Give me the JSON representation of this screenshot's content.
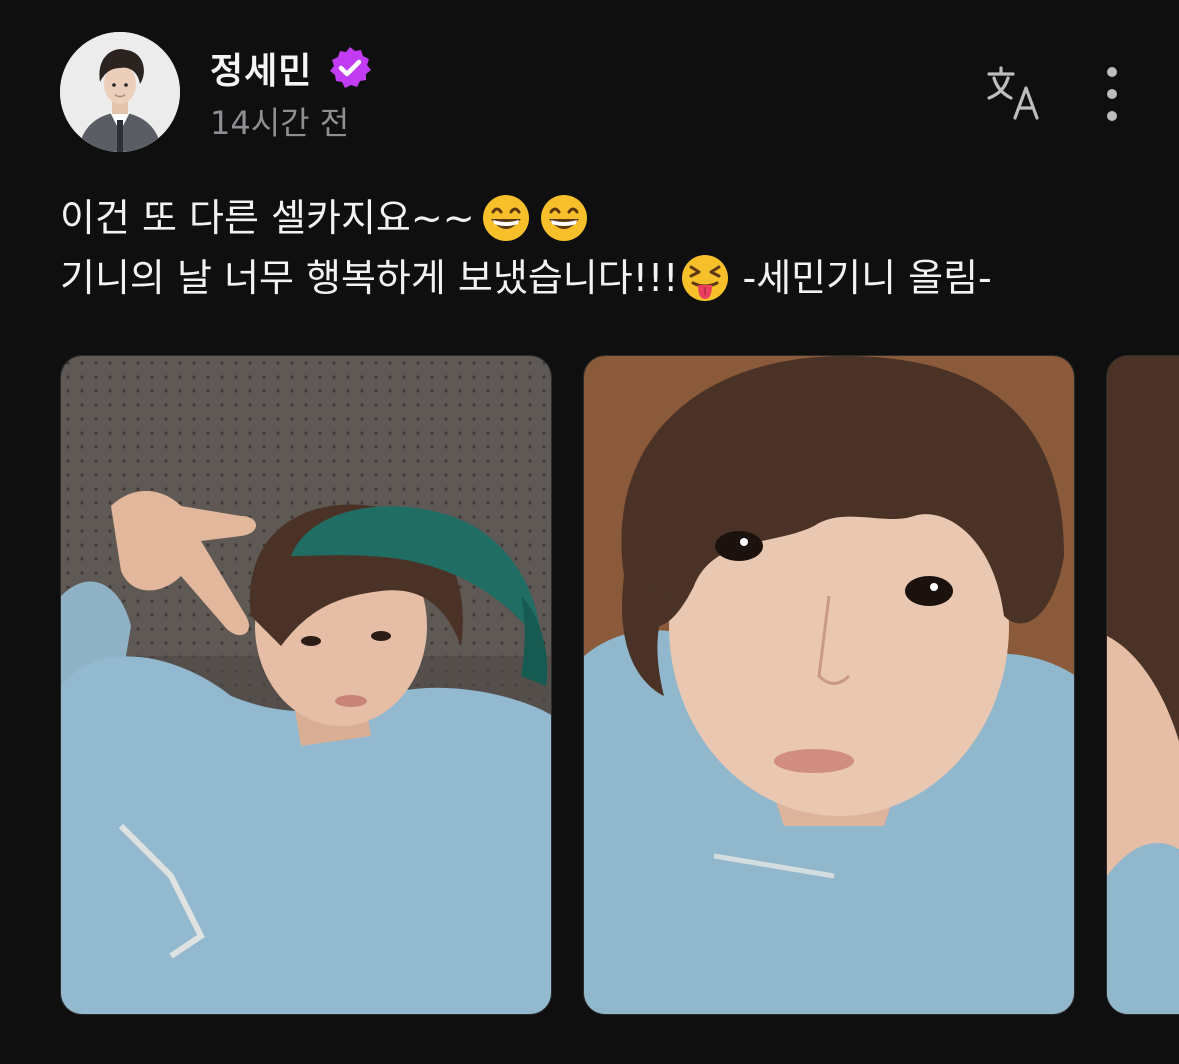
{
  "author": {
    "name": "정세민",
    "timestamp": "14시간 전",
    "verified": true,
    "avatar_icon": "avatar-photo",
    "badge_color": "#c13cf2"
  },
  "actions": {
    "translate_icon": "translate-icon",
    "more_icon": "more-vertical-icon"
  },
  "post": {
    "line1_text": "이건 또 다른 셀카지요~~",
    "line1_emojis": [
      "grinning-face-icon",
      "grinning-face-icon"
    ],
    "line2_text": "기니의 날 너무 행복하게 보냈습니다!!!",
    "line2_emoji": "squinting-tongue-face-icon",
    "line2_suffix": " -세민기니 올림-"
  },
  "gallery": {
    "photos": [
      "selfie-photo-green-cap",
      "selfie-photo-closeup",
      "selfie-photo-partial"
    ]
  },
  "colors": {
    "background": "#0f0f0f",
    "text": "#f2f2f2",
    "muted": "#8e8e93",
    "verified_badge": "#c13cf2"
  }
}
